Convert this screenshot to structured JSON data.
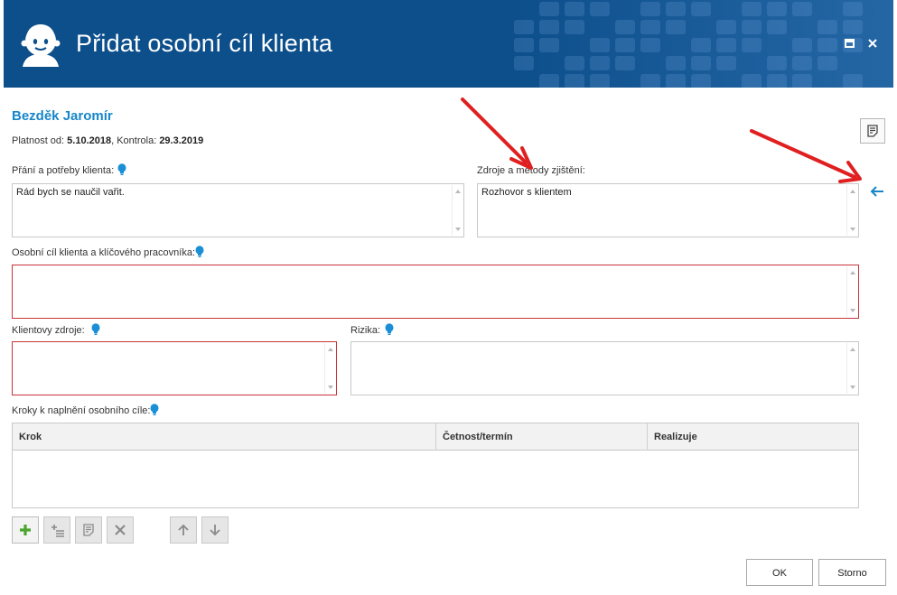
{
  "window": {
    "title": "Přidat osobní cíl klienta",
    "maximize_icon": "maximize-icon",
    "close_icon": "close-icon",
    "logo_icon": "client-face-logo-icon"
  },
  "client": {
    "name": "Bezděk Jaromír",
    "validity_label": "Platnost od:",
    "validity_value": "5.10.2018",
    "control_label": "Kontrola:",
    "control_value": "29.3.2019"
  },
  "fields": {
    "wishes": {
      "label": "Přání a potřeby klienta:",
      "value": "Rád bych se naučil vařit."
    },
    "sources": {
      "label": "Zdroje a metody zjištění:",
      "value": "Rozhovor s klientem"
    },
    "goal": {
      "label": "Osobní cíl klienta a klíčového pracovníka:",
      "value": ""
    },
    "client_resources": {
      "label": "Klientovy zdroje:",
      "value": ""
    },
    "risks": {
      "label": "Rizika:",
      "value": ""
    },
    "steps": {
      "label": "Kroky k naplnění osobního cíle:"
    }
  },
  "steps_table": {
    "columns": [
      "Krok",
      "Četnost/termín",
      "Realizuje"
    ],
    "rows": []
  },
  "toolbar": {
    "items": [
      "add-icon",
      "add-subitem-icon",
      "edit-note-icon",
      "delete-icon",
      "move-up-icon",
      "move-down-icon"
    ]
  },
  "buttons": {
    "ok": "OK",
    "cancel": "Storno"
  },
  "colors": {
    "titlebar": "#0d4f8b",
    "accent": "#1787c8",
    "required_border": "#c8343a",
    "annotation_arrow": "#e02020",
    "add_green": "#4aa52e"
  }
}
